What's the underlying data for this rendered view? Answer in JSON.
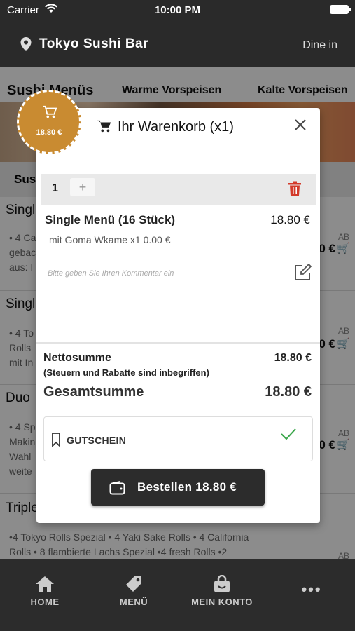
{
  "status_bar": {
    "carrier": "Carrier",
    "time": "10:00 PM"
  },
  "header": {
    "restaurant": "Tokyo Sushi Bar",
    "mode": "Dine in"
  },
  "categories": [
    "Sushi Menüs",
    "Warme Vorspeisen",
    "Kalte Vorspeisen"
  ],
  "background": {
    "section_title": "Sus",
    "ab_label": "AB",
    "items": [
      {
        "title": "Singl",
        "desc_lines": [
          "• 4 Ca",
          "gebac",
          "aus: I"
        ],
        "price_fragment": "0 €"
      },
      {
        "title": "Singl",
        "desc_lines": [
          "• 4 To",
          "Rolls",
          "mit In"
        ],
        "price_fragment": "0 €"
      },
      {
        "title": "Duo",
        "desc_lines": [
          "• 4 Sp",
          "Makin",
          "Wahl",
          "weite"
        ],
        "price_fragment": "0 €"
      },
      {
        "title": "Triple",
        "desc_lines": [
          "•4 Tokyo Rolls Spezial • 4 Yaki Sake Rolls • 4 California",
          "Rolls • 8 flambierte Lachs Spezial •4 fresh Rolls •2"
        ],
        "price_fragment": ""
      }
    ]
  },
  "cart_badge": {
    "price": "18.80 €"
  },
  "modal": {
    "title": "Ihr Warenkorb (x1)",
    "quantity": "1",
    "plus_label": "+",
    "item_name": "Single Menü (16 Stück)",
    "item_price": "18.80 €",
    "item_option": "mit Goma Wkame x1 0.00 €",
    "comment_placeholder": "Bitte geben Sie Ihren Kommentar ein",
    "net_label": "Nettosumme",
    "net_value": "18.80 €",
    "tax_note": "(Steuern und Rabatte sind inbegriffen)",
    "total_label": "Gesamtsumme",
    "total_value": "18.80 €",
    "voucher_label": "GUTSCHEIN",
    "order_label": "Bestellen 18.80 €"
  },
  "tab_bar": {
    "home": "HOME",
    "menu": "MENÜ",
    "account": "MEIN KONTO",
    "more": "•••"
  },
  "colors": {
    "accent": "#c98b31",
    "dark": "#2c2c2c",
    "danger": "#d33a2a",
    "success": "#3aa64a"
  }
}
